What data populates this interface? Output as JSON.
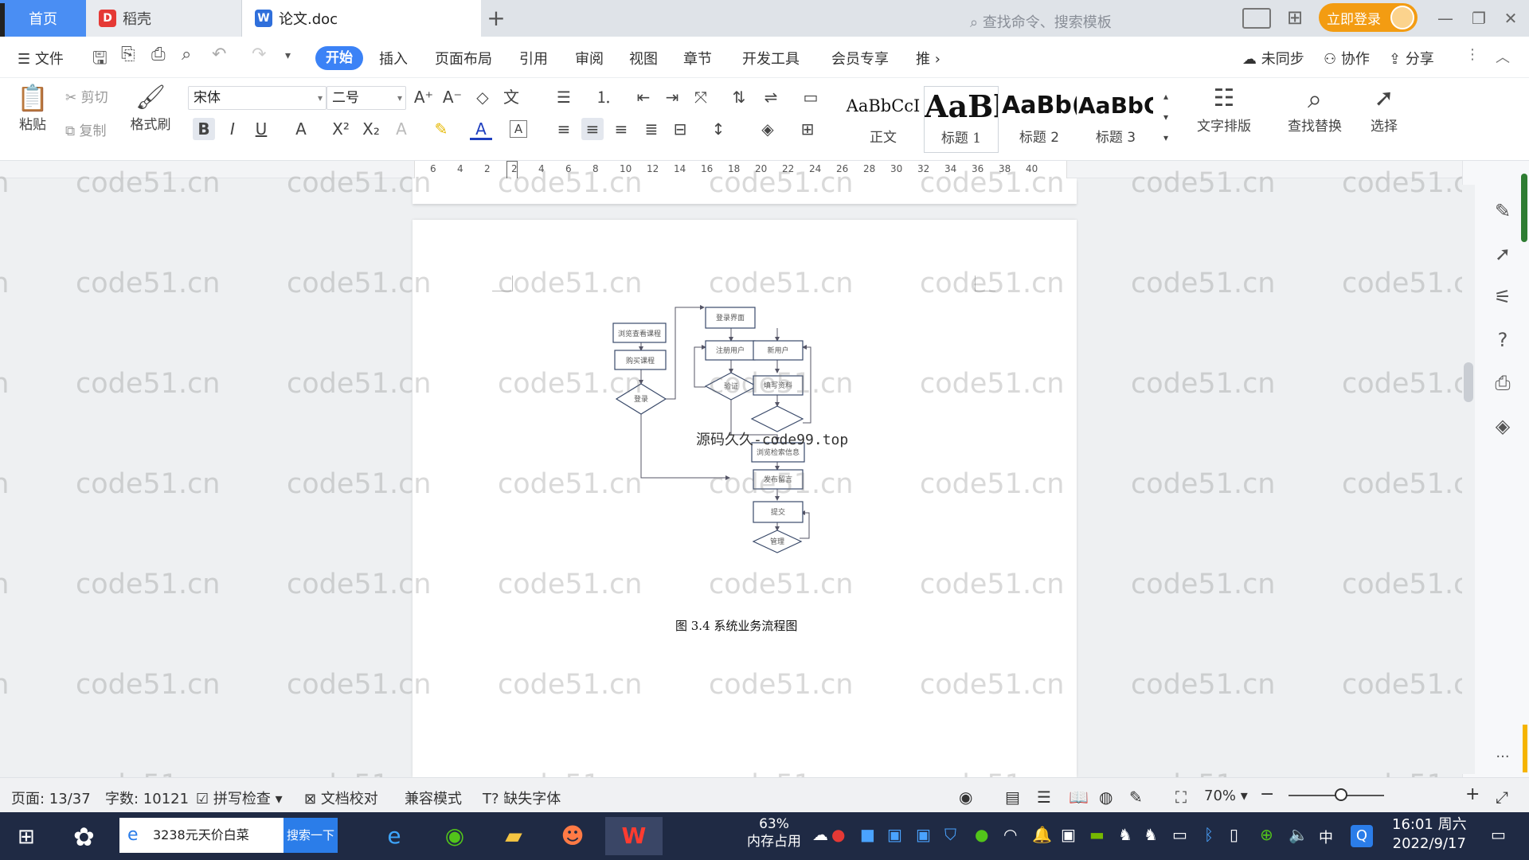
{
  "tabs": {
    "home": "首页",
    "daoke": "稻壳",
    "doc": "论文.doc"
  },
  "titlebar": {
    "login": "立即登录"
  },
  "menu": {
    "file": "文件",
    "items": [
      "开始",
      "插入",
      "页面布局",
      "引用",
      "审阅",
      "视图",
      "章节",
      "开发工具",
      "会员专享",
      "推"
    ],
    "search_cmd": "查找命令、搜索模板",
    "right": [
      "未同步",
      "协作",
      "分享"
    ]
  },
  "ribbon": {
    "paste": "粘贴",
    "cut": "剪切",
    "copy": "复制",
    "format_painter": "格式刷",
    "font_name": "宋体",
    "font_size": "二号",
    "styles": [
      {
        "preview": "AaBbCcI",
        "label": "正文"
      },
      {
        "preview": "AaBl",
        "label": "标题 1"
      },
      {
        "preview": "AaBb(",
        "label": "标题 2"
      },
      {
        "preview": "AaBbC",
        "label": "标题 3"
      }
    ],
    "text_layout": "文字排版",
    "find_replace": "查找替换",
    "select": "选择"
  },
  "ruler": {
    "ticks": [
      "6",
      "4",
      "2",
      "2",
      "4",
      "6",
      "8",
      "10",
      "12",
      "14",
      "16",
      "18",
      "20",
      "22",
      "24",
      "26",
      "28",
      "30",
      "32",
      "34",
      "36",
      "38",
      "40"
    ]
  },
  "watermark": "code51.cn",
  "overlay": "源码久久-code99.top",
  "flowchart": {
    "nodes": [
      "浏览查看课程",
      "购买课程",
      "登录",
      "登录界面",
      "注册用户",
      "新用户",
      "验证",
      "填写资料",
      "浏览检索信息",
      "发布留言",
      "提交",
      "管理"
    ]
  },
  "caption": "图 3.4 系统业务流程图",
  "status": {
    "page": "页面: 13/37",
    "words": "字数: 10121",
    "spell": "拼写检查",
    "proof": "文档校对",
    "compat": "兼容模式",
    "missing_font": "缺失字体",
    "zoom": "70%"
  },
  "taskbar": {
    "search_text": "3238元天价白菜",
    "search_btn": "搜索一下",
    "mem_pct": "63%",
    "mem_label": "内存占用",
    "ime": "中",
    "time": "16:01 周六",
    "date": "2022/9/17"
  }
}
